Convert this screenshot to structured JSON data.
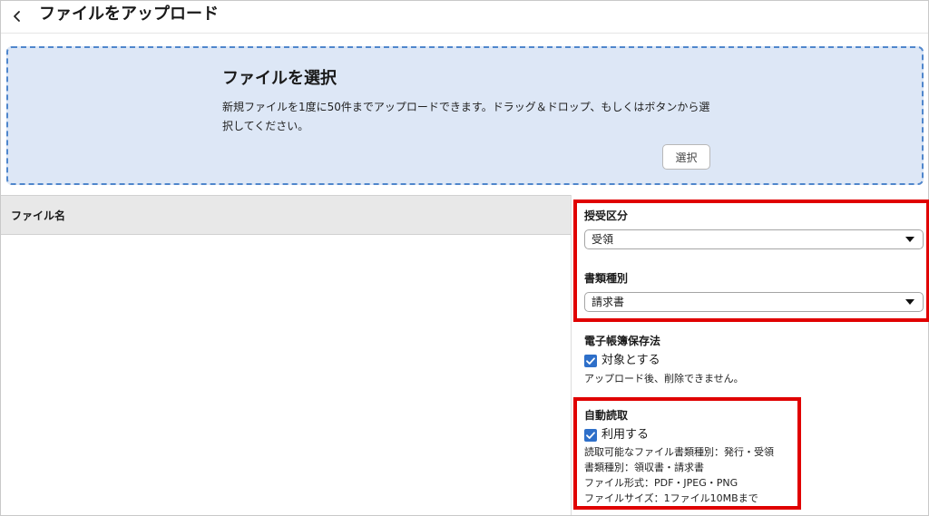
{
  "header": {
    "title": "ファイルをアップロード",
    "back_icon": "chevron-left-icon"
  },
  "dropzone": {
    "title": "ファイルを選択",
    "description": "新規ファイルを1度に50件までアップロードできます。ドラッグ＆ドロップ、もしくはボタンから選択してください。",
    "select_button": "選択"
  },
  "file_table": {
    "column_header": "ファイル名",
    "rows": []
  },
  "side_panel": {
    "transfer_type": {
      "label": "授受区分",
      "selected": "受領"
    },
    "document_type": {
      "label": "書類種別",
      "selected": "請求書"
    },
    "e_book_law": {
      "label": "電子帳簿保存法",
      "checkbox_label": "対象とする",
      "checked": true,
      "note": "アップロード後、削除できません。"
    },
    "auto_read": {
      "label": "自動読取",
      "checkbox_label": "利用する",
      "checked": true,
      "notes": [
        "読取可能なファイル書類種別：発行・受領",
        "書類種別：領収書・請求書",
        "ファイル形式：PDF・JPEG・PNG",
        "ファイルサイズ：1ファイル10MBまで"
      ]
    }
  },
  "colors": {
    "dropzone_bg": "#dde7f6",
    "dropzone_border": "#4f86cc",
    "checkbox": "#2e6fc9",
    "highlight": "#e00000",
    "table_header_bg": "#e8e8e8"
  }
}
